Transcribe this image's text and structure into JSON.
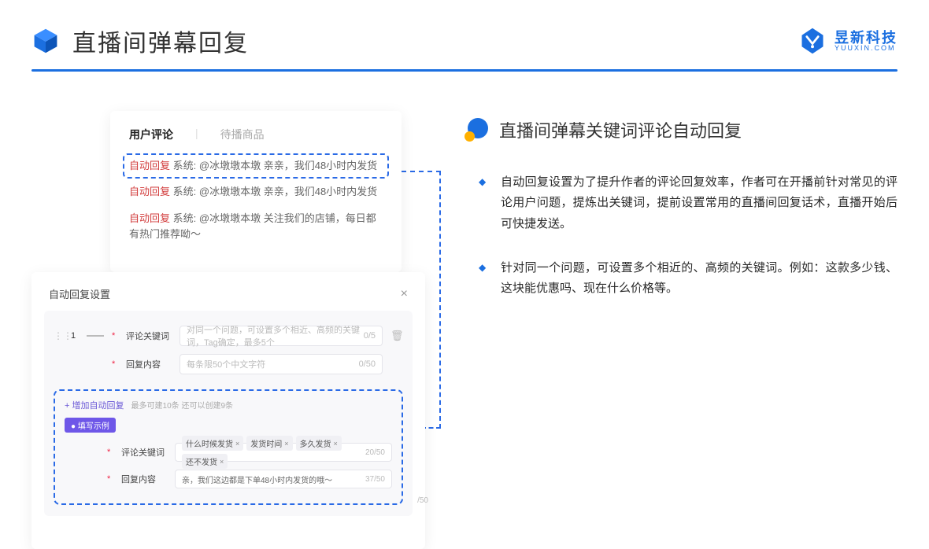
{
  "header": {
    "title": "直播间弹幕回复",
    "brand_name": "昱新科技",
    "brand_sub": "YUUXIN.COM"
  },
  "comments_panel": {
    "tabs": {
      "active": "用户评论",
      "inactive": "待播商品"
    },
    "auto_reply_label": "自动回复",
    "system_label": "系统:",
    "rows": [
      {
        "at": "@冰墩墩本墩",
        "body": "亲亲，我们48小时内发货",
        "highlight": true
      },
      {
        "at": "@冰墩墩本墩",
        "body": "亲亲，我们48小时内发货",
        "highlight": false
      },
      {
        "at": "@冰墩墩本墩",
        "body": "关注我们的店铺，每日都有热门推荐呦～",
        "highlight": false
      }
    ]
  },
  "settings_panel": {
    "title": "自动回复设置",
    "row_num": "1",
    "label_keyword": "评论关键词",
    "label_content": "回复内容",
    "keyword_placeholder": "对同一个问题，可设置多个相近、高频的关键词，Tag确定，最多5个",
    "keyword_counter": "0/5",
    "content_placeholder": "每条限50个中文字符",
    "content_counter": "0/50",
    "add_text": "+ 增加自动回复",
    "add_hint": "最多可建10条 还可以创建9条",
    "example_badge": "● 填写示例",
    "example_keyword_label": "评论关键词",
    "example_chips": [
      "什么时候发货",
      "发货时间",
      "多久发货",
      "还不发货"
    ],
    "example_keyword_counter": "20/50",
    "example_content_label": "回复内容",
    "example_content_value": "亲，我们这边都是下单48小时内发货的哦～",
    "example_content_counter": "37/50",
    "stray_counter": "/50"
  },
  "right": {
    "section_title": "直播间弹幕关键词评论自动回复",
    "bullets": [
      "自动回复设置为了提升作者的评论回复效率，作者可在开播前针对常见的评论用户问题，提炼出关键词，提前设置常用的直播间回复话术，直播开始后可快捷发送。",
      "针对同一个问题，可设置多个相近的、高频的关键词。例如：这款多少钱、这块能优惠吗、现在什么价格等。"
    ]
  }
}
